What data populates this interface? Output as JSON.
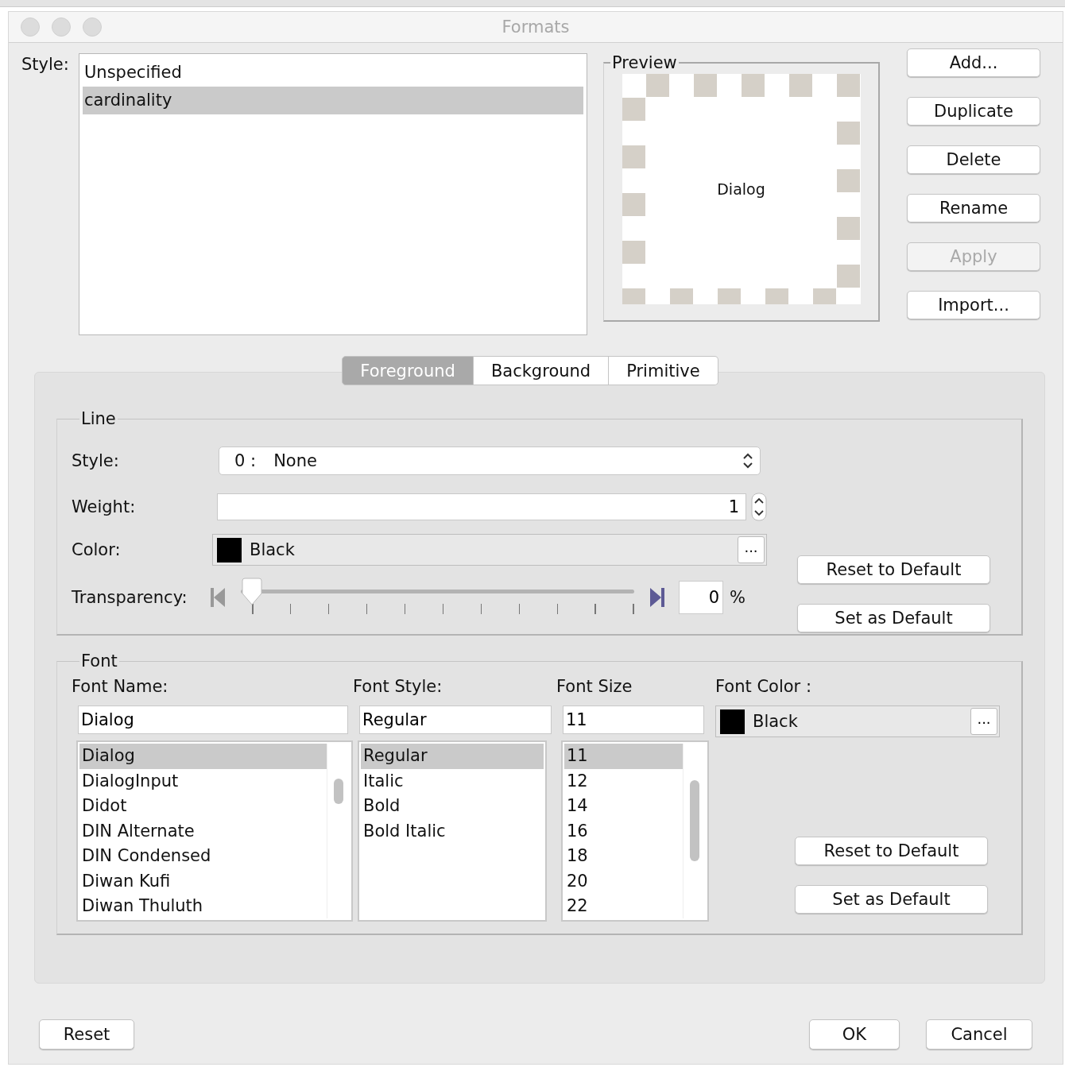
{
  "window": {
    "title": "Formats"
  },
  "style_list": {
    "label": "Style:",
    "items": [
      {
        "text": "Unspecified",
        "selected": false
      },
      {
        "text": "cardinality",
        "selected": true
      }
    ]
  },
  "preview": {
    "title": "Preview",
    "sample": "Dialog"
  },
  "side_buttons": [
    {
      "label": "Add...",
      "disabled": false
    },
    {
      "label": "Duplicate",
      "disabled": false
    },
    {
      "label": "Delete",
      "disabled": false
    },
    {
      "label": "Rename",
      "disabled": false
    },
    {
      "label": "Apply",
      "disabled": true
    },
    {
      "label": "Import...",
      "disabled": false
    }
  ],
  "tabs": [
    {
      "label": "Foreground",
      "selected": true
    },
    {
      "label": "Background",
      "selected": false
    },
    {
      "label": "Primitive",
      "selected": false
    }
  ],
  "line": {
    "title": "Line",
    "style": {
      "label": "Style:",
      "number": "0 :",
      "value": "None"
    },
    "weight": {
      "label": "Weight:",
      "value": "1"
    },
    "color": {
      "label": "Color:",
      "value": "Black",
      "color": "#000000",
      "more": "..."
    },
    "transparency": {
      "label": "Transparency:",
      "level": 0,
      "value": "0",
      "unit": "%"
    },
    "buttons": [
      "Reset to Default",
      "Set as Default"
    ]
  },
  "font": {
    "title": "Font",
    "name": {
      "label": "Font Name:",
      "value": "Dialog",
      "items": [
        {
          "text": "Dialog",
          "selected": true
        },
        {
          "text": "DialogInput",
          "selected": false
        },
        {
          "text": "Didot",
          "selected": false
        },
        {
          "text": "DIN Alternate",
          "selected": false
        },
        {
          "text": "DIN Condensed",
          "selected": false
        },
        {
          "text": "Diwan Kufi",
          "selected": false
        },
        {
          "text": "Diwan Thuluth",
          "selected": false
        }
      ]
    },
    "style": {
      "label": "Font Style:",
      "value": "Regular",
      "items": [
        {
          "text": "Regular",
          "selected": true
        },
        {
          "text": "Italic",
          "selected": false
        },
        {
          "text": "Bold",
          "selected": false
        },
        {
          "text": "Bold Italic",
          "selected": false
        }
      ]
    },
    "size": {
      "label": "Font Size",
      "value": "11",
      "items": [
        {
          "text": "11",
          "selected": true
        },
        {
          "text": "12",
          "selected": false
        },
        {
          "text": "14",
          "selected": false
        },
        {
          "text": "16",
          "selected": false
        },
        {
          "text": "18",
          "selected": false
        },
        {
          "text": "20",
          "selected": false
        },
        {
          "text": "22",
          "selected": false
        }
      ]
    },
    "color": {
      "label": "Font Color :",
      "value": "Black",
      "color": "#000000",
      "more": "..."
    },
    "buttons": [
      "Reset to Default",
      "Set as Default"
    ]
  },
  "footer": {
    "left": [
      "Reset"
    ],
    "right": [
      "OK",
      "Cancel"
    ]
  }
}
